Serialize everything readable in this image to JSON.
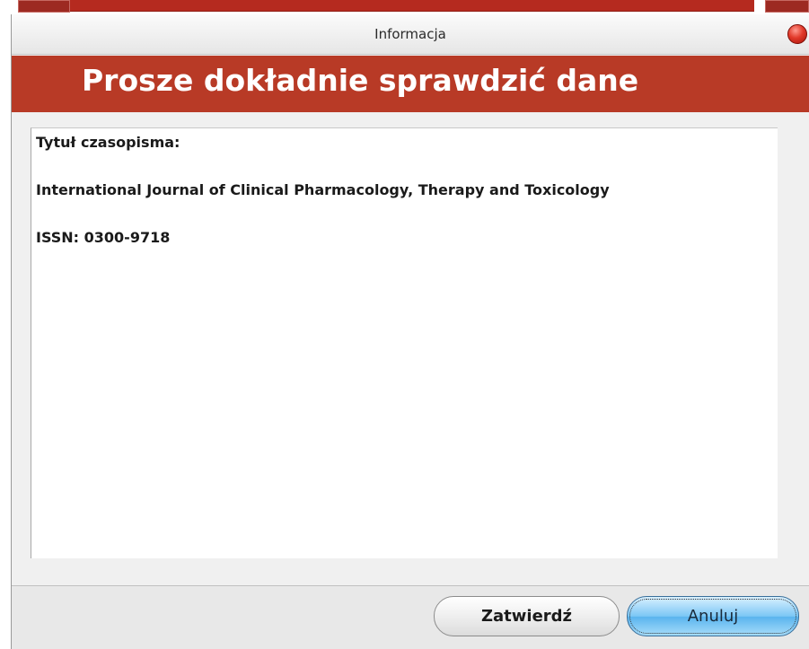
{
  "window": {
    "title": "Informacja"
  },
  "banner": {
    "heading": "Prosze dokładnie sprawdzić dane"
  },
  "details": {
    "title_label": "Tytuł czasopisma:",
    "title_value": "International Journal of Clinical Pharmacology, Therapy and Toxicology",
    "issn": "ISSN: 0300-9718"
  },
  "buttons": {
    "confirm_label": "Zatwierdź",
    "cancel_label": "Anuluj"
  },
  "colors": {
    "banner_red": "#b83a26",
    "cancel_blue": "#7cc7f5",
    "close_red": "#e23a2a"
  }
}
